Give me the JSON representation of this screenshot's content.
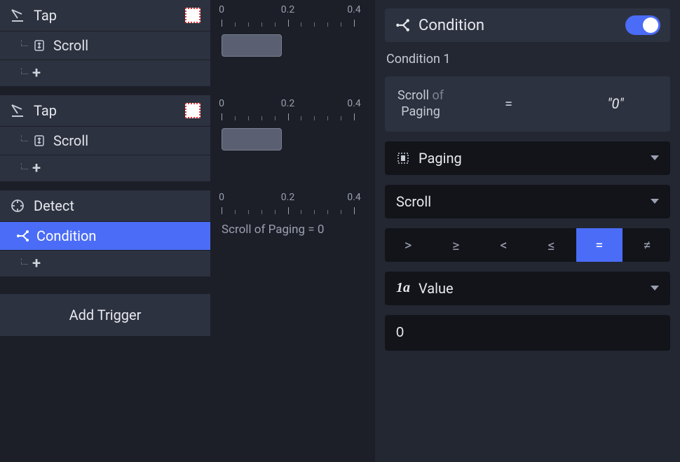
{
  "timeline": {
    "ticks": [
      0,
      0.2,
      0.4
    ]
  },
  "triggers": [
    {
      "label": "Tap",
      "icon": "tap-icon",
      "swatch": true,
      "timeline": true,
      "children": [
        {
          "label": "Scroll",
          "icon": "scroll-icon",
          "has_clip": true
        }
      ]
    },
    {
      "label": "Tap",
      "icon": "tap-icon",
      "swatch": true,
      "timeline": true,
      "children": [
        {
          "label": "Scroll",
          "icon": "scroll-icon",
          "has_clip": true
        }
      ]
    },
    {
      "label": "Detect",
      "icon": "detect-icon",
      "swatch": false,
      "timeline": true,
      "summary": "Scroll of Paging = 0",
      "children": [
        {
          "label": "Condition",
          "icon": "condition-icon",
          "selected": true
        }
      ]
    }
  ],
  "add_trigger_label": "Add Trigger",
  "inspector": {
    "title": "Condition",
    "toggle_on": true,
    "section_label": "Condition 1",
    "expr": {
      "prop": "Scroll",
      "of_word": "of",
      "target": "Paging",
      "op": "=",
      "value_display": "\"0\""
    },
    "target_select": {
      "label": "Paging",
      "icon": "target-bounds-icon"
    },
    "prop_select": {
      "label": "Scroll"
    },
    "operators": [
      ">",
      "≥",
      "<",
      "≤",
      "=",
      "≠"
    ],
    "operator_selected": "=",
    "value_mode": {
      "label": "Value",
      "prefix": "1a"
    },
    "value_input": "0"
  }
}
